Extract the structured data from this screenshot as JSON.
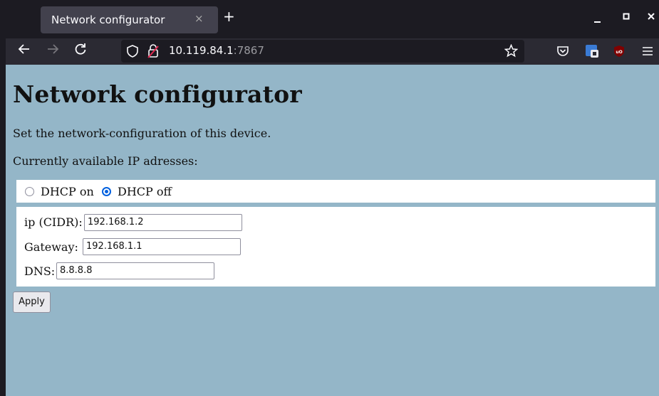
{
  "browser": {
    "tab_title": "Network configurator",
    "tab_close": "×",
    "new_tab": "+",
    "url_host": "10.119.84.1",
    "url_port": ":7867",
    "icons": [
      "back-icon",
      "forward-icon",
      "reload-icon",
      "shield-icon",
      "insecure-lock-icon",
      "bookmark-star-icon",
      "pocket-icon",
      "extension-icon",
      "ublock-icon",
      "menu-icon"
    ],
    "window_controls": [
      "minimize",
      "maximize",
      "close"
    ]
  },
  "page": {
    "title": "Network configurator",
    "description": "Set the network-configuration of this device.",
    "available_label": "Currently available IP adresses:",
    "dhcp_on_label": "DHCP on",
    "dhcp_off_label": "DHCP off",
    "dhcp_selected": "DHCP off",
    "ip_label": "ip (CIDR):",
    "ip_value": "192.168.1.2",
    "gateway_label": "Gateway:",
    "gateway_value": "192.168.1.1",
    "dns_label": "DNS:",
    "dns_value": "8.8.8.8",
    "apply_label": "Apply"
  },
  "colors": {
    "page_background": "#94b6c8",
    "radio_accent": "#0060df",
    "ublock_red": "#800000"
  }
}
